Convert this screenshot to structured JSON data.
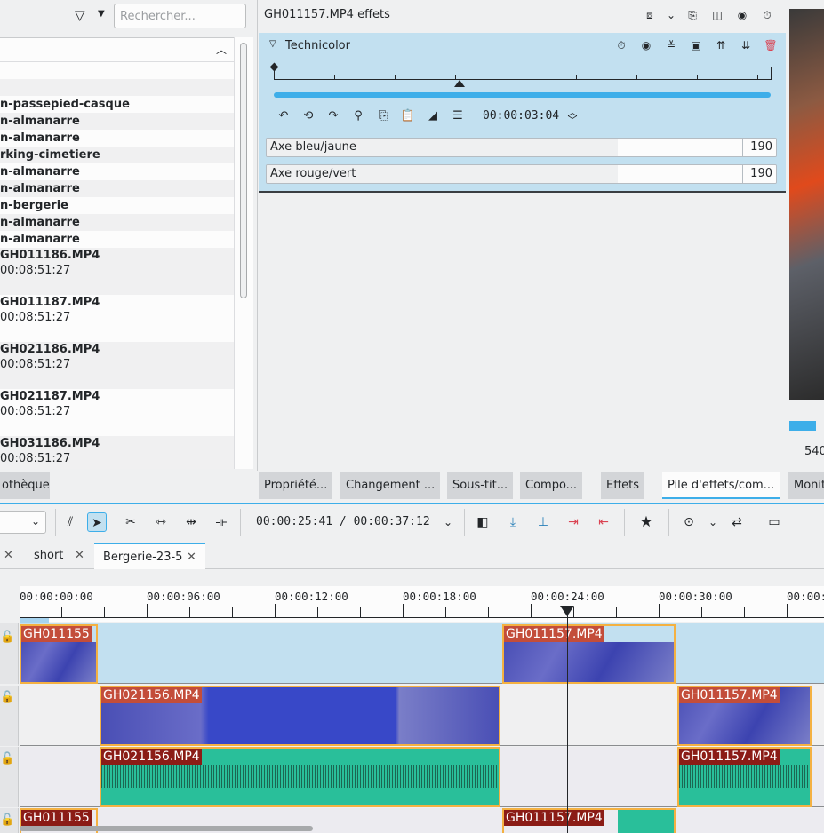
{
  "bin": {
    "search_placeholder": "Rechercher...",
    "folders": [
      "n-passepied-casque",
      "n-almanarre",
      "n-almanarre",
      "rking-cimetiere",
      "n-almanarre",
      "n-almanarre",
      "n-bergerie",
      "n-almanarre",
      "n-almanarre"
    ],
    "clips": [
      {
        "name": "GH011186.MP4",
        "duration": "00:08:51:27"
      },
      {
        "name": "GH011187.MP4",
        "duration": "00:08:51:27"
      },
      {
        "name": "GH021186.MP4",
        "duration": "00:08:51:27"
      },
      {
        "name": "GH021187.MP4",
        "duration": "00:08:51:27"
      },
      {
        "name": "GH031186.MP4",
        "duration": "00:08:51:27"
      }
    ]
  },
  "effects": {
    "title": "GH011157.MP4 effets",
    "effect_name": "Technicolor",
    "keyframe_time": "00:00:03:04",
    "params": [
      {
        "label": "Axe bleu/jaune",
        "value": "190",
        "fill": 0.69
      },
      {
        "label": "Axe rouge/vert",
        "value": "190",
        "fill": 0.69
      }
    ]
  },
  "monitor": {
    "value": "540"
  },
  "dock_tabs": [
    "othèque",
    "Propriété...",
    "Changement ...",
    "Sous-tit...",
    "Compo...",
    "Effets",
    "Pile d'effets/com...",
    "Monit"
  ],
  "timeline_toolbar": {
    "time": "00:00:25:41 / 00:00:37:12"
  },
  "timeline_tabs": [
    "short",
    "Bergerie-23-5"
  ],
  "ruler_labels": [
    "00:00:00:00",
    "00:00:06:00",
    "00:00:12:00",
    "00:00:18:00",
    "00:00:24:00",
    "00:00:30:00",
    "00:00:"
  ],
  "clips": {
    "v1a": "GH011155",
    "v1b": "GH011157.MP4",
    "v2a": "GH021156.MP4",
    "v2b": "GH011157.MP4",
    "a1a": "GH021156.MP4",
    "a1b": "GH011157.MP4",
    "a2a": "GH011155",
    "a2b": "GH011157.MP4"
  },
  "colors": {
    "accent": "#3daee9",
    "effect_bg": "#c2e0f0",
    "clip_border": "#f4b142",
    "audio": "#29bf9a"
  }
}
